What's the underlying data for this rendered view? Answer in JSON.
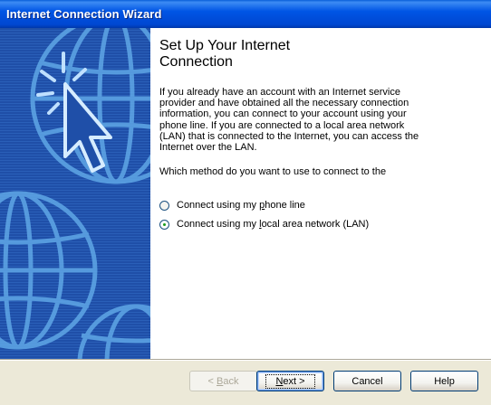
{
  "window": {
    "title": "Internet Connection Wizard"
  },
  "wizard": {
    "heading_line1": "Set Up Your Internet",
    "heading_line2": "Connection",
    "description": "If you already have an account with an Internet service provider and have obtained all the necessary connection information, you can connect to your account using your phone line. If you are connected to a local area network (LAN) that is connected to the Internet, you can access the Internet over the LAN.",
    "question": "Which method do you want to use to connect to the",
    "options": [
      {
        "pre": "Connect using my ",
        "accel": "p",
        "post": "hone line",
        "selected": false
      },
      {
        "pre": "Connect using my ",
        "accel": "l",
        "post": "ocal area network (LAN)",
        "selected": true
      }
    ]
  },
  "buttons": {
    "back": {
      "pre": "< ",
      "accel": "B",
      "post": "ack",
      "enabled": false
    },
    "next": {
      "pre": "",
      "accel": "N",
      "post": "ext >",
      "enabled": true
    },
    "cancel": {
      "label": "Cancel"
    },
    "help": {
      "label": "Help"
    }
  },
  "colors": {
    "titlebar": "#0055e5",
    "side_panel": "#1f4fa8",
    "side_art": "#5fa7e6",
    "radio_check": "#1a9c1a"
  },
  "icons": {
    "side_art": "globe-cursor-icon"
  }
}
